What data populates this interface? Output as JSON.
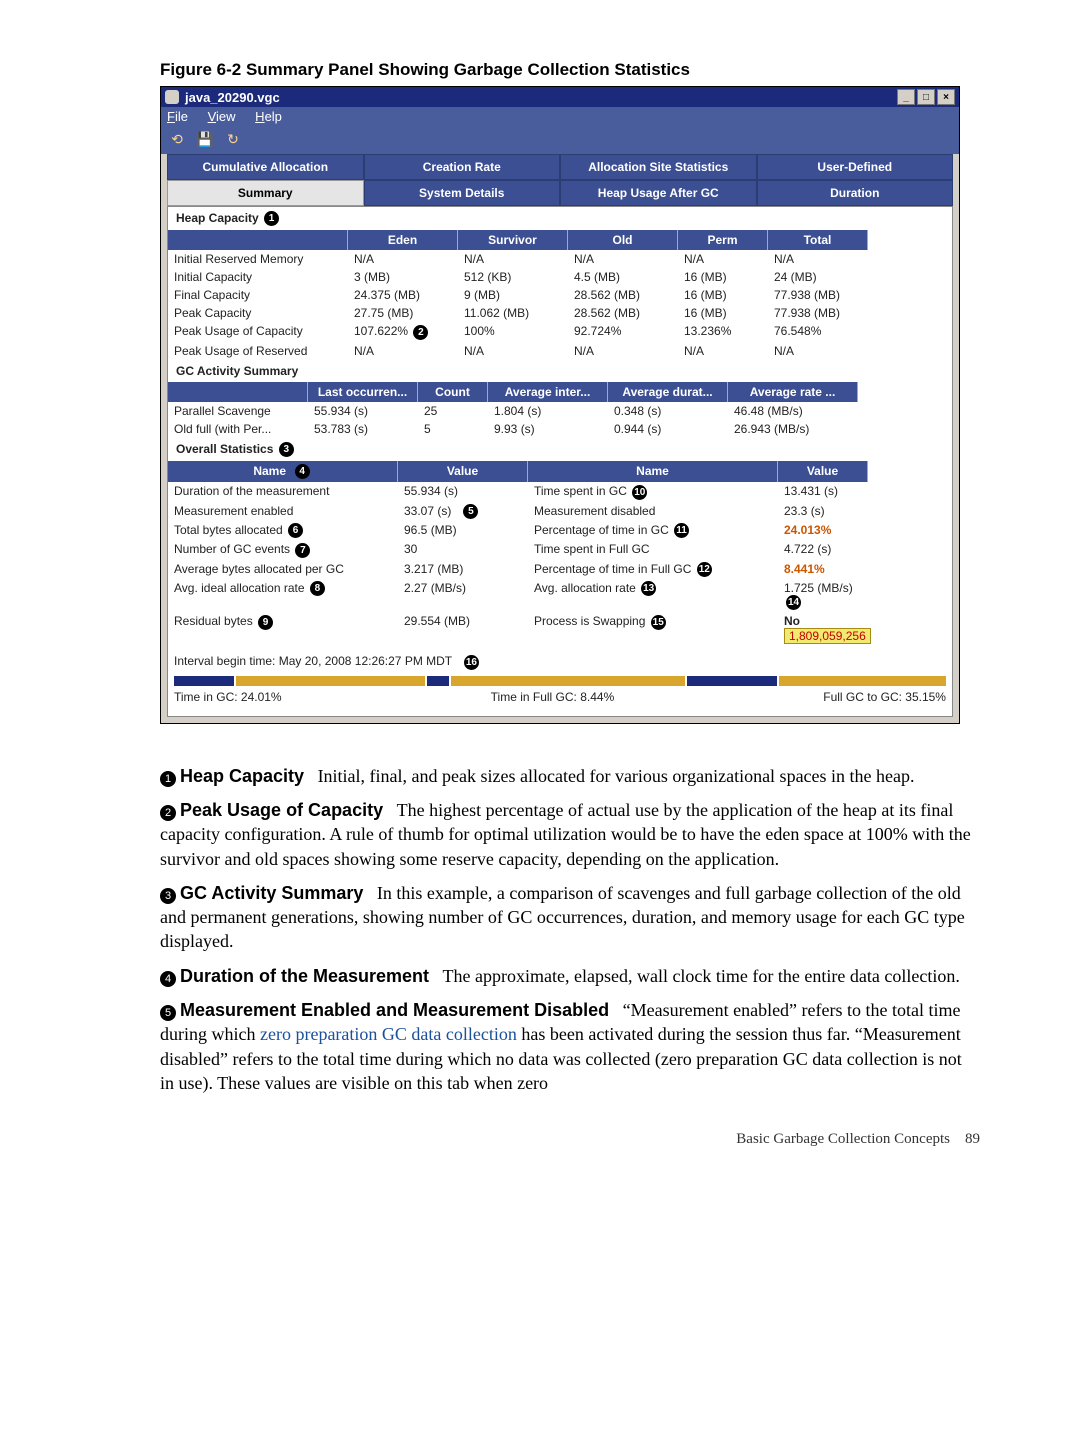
{
  "figure_title": "Figure 6-2 Summary Panel Showing Garbage Collection Statistics",
  "window": {
    "title": "java_20290.vgc",
    "menus": {
      "file": "File",
      "view": "View",
      "help": "Help"
    },
    "tabs_row1": {
      "cumulative": "Cumulative Allocation",
      "creation": "Creation Rate",
      "site": "Allocation Site Statistics",
      "user": "User-Defined"
    },
    "tabs_row2": {
      "summary": "Summary",
      "sysdetails": "System Details",
      "heapusage": "Heap Usage After GC",
      "duration": "Duration"
    }
  },
  "heap_capacity": {
    "header": "Heap Capacity",
    "cols": {
      "c0": "",
      "eden": "Eden",
      "surv": "Survivor",
      "old": "Old",
      "perm": "Perm",
      "total": "Total"
    },
    "rows": [
      {
        "label": "Initial Reserved Memory",
        "eden": "N/A",
        "surv": "N/A",
        "old": "N/A",
        "perm": "N/A",
        "total": "N/A"
      },
      {
        "label": "Initial Capacity",
        "eden": "3 (MB)",
        "surv": "512 (KB)",
        "old": "4.5 (MB)",
        "perm": "16 (MB)",
        "total": "24 (MB)"
      },
      {
        "label": "Final Capacity",
        "eden": "24.375 (MB)",
        "surv": "9 (MB)",
        "old": "28.562 (MB)",
        "perm": "16 (MB)",
        "total": "77.938 (MB)"
      },
      {
        "label": "Peak Capacity",
        "eden": "27.75 (MB)",
        "surv": "11.062 (MB)",
        "old": "28.562 (MB)",
        "perm": "16 (MB)",
        "total": "77.938 (MB)"
      },
      {
        "label": "Peak Usage of Capacity",
        "eden": "107.622%",
        "surv": "100%",
        "old": "92.724%",
        "perm": "13.236%",
        "total": "76.548%"
      },
      {
        "label": "Peak Usage of Reserved",
        "eden": "N/A",
        "surv": "N/A",
        "old": "N/A",
        "perm": "N/A",
        "total": "N/A"
      }
    ]
  },
  "gc_activity": {
    "header": "GC Activity Summary",
    "cols": {
      "c0": "",
      "last": "Last occurren...",
      "count": "Count",
      "avgi": "Average inter...",
      "avgd": "Average durat...",
      "avgr": "Average rate ..."
    },
    "rows": [
      {
        "label": "Parallel Scavenge",
        "last": "55.934 (s)",
        "count": "25",
        "avgi": "1.804 (s)",
        "avgd": "0.348 (s)",
        "avgr": "46.48 (MB/s)"
      },
      {
        "label": "Old full (with Per...",
        "last": "53.783 (s)",
        "count": "5",
        "avgi": "9.93 (s)",
        "avgd": "0.944 (s)",
        "avgr": "26.943 (MB/s)"
      }
    ]
  },
  "overall": {
    "header": "Overall Statistics",
    "cols": {
      "n1": "Name",
      "v1": "Value",
      "n2": "Name",
      "v2": "Value"
    },
    "rows": [
      {
        "n1": "Duration of the measurement",
        "v1": "55.934 (s)",
        "n2": "Time spent in GC",
        "v2": "13.431 (s)"
      },
      {
        "n1": "Measurement enabled",
        "v1": "33.07 (s)",
        "n2": "Measurement disabled",
        "v2": "23.3 (s)"
      },
      {
        "n1": "Total bytes allocated",
        "v1": "96.5 (MB)",
        "n2": "Percentage of time in GC",
        "v2": "24.013%"
      },
      {
        "n1": "Number of GC events",
        "v1": "30",
        "n2": "Time spent in Full GC",
        "v2": "4.722 (s)"
      },
      {
        "n1": "Average bytes allocated per GC",
        "v1": "3.217 (MB)",
        "n2": "Percentage of time in Full GC",
        "v2": "8.441%"
      },
      {
        "n1": "Avg. ideal allocation rate",
        "v1": "2.27 (MB/s)",
        "n2": "Avg. allocation rate",
        "v2": "1.725 (MB/s)"
      },
      {
        "n1": "Residual bytes",
        "v1": "29.554 (MB)",
        "n2": "Process is Swapping",
        "v2": "No"
      }
    ],
    "swap_number": "1,809,059,256",
    "interval_line": "Interval begin time: May 20, 2008 12:26:27 PM MDT",
    "stats": {
      "gc": "Time in GC: 24.01%",
      "fullgc": "Time in Full GC: 8.44%",
      "ratio": "Full GC to GC: 35.15%"
    }
  },
  "definitions": {
    "d1_lead": "Heap Capacity",
    "d1_text": "Initial, final, and peak sizes allocated for various organizational spaces in the heap.",
    "d2_lead": "Peak Usage of Capacity",
    "d2_text": "The highest percentage of actual use by the application of the heap at its final capacity configuration. A rule of thumb for optimal utilization would be to have the eden space at 100% with the survivor and old spaces showing some reserve capacity, depending on the application.",
    "d3_lead": "GC Activity Summary",
    "d3_text": "In this example, a comparison of scavenges and full garbage collection of the old and permanent generations, showing number of GC occurrences, duration, and memory usage for each GC type displayed.",
    "d4_lead": "Duration of the Measurement",
    "d4_text": "The approximate, elapsed, wall clock time for the entire data collection.",
    "d5_lead": "Measurement Enabled and Measurement Disabled",
    "d5_pre": "“Measurement enabled” refers to the total time during which ",
    "d5_link": "zero preparation GC data collection",
    "d5_post": " has been activated during the session thus far. “Measurement disabled” refers to the total time during which no data was collected (zero preparation GC data collection is not in use). These values are visible on this tab when zero"
  },
  "footer": {
    "section": "Basic Garbage Collection Concepts",
    "page": "89"
  }
}
